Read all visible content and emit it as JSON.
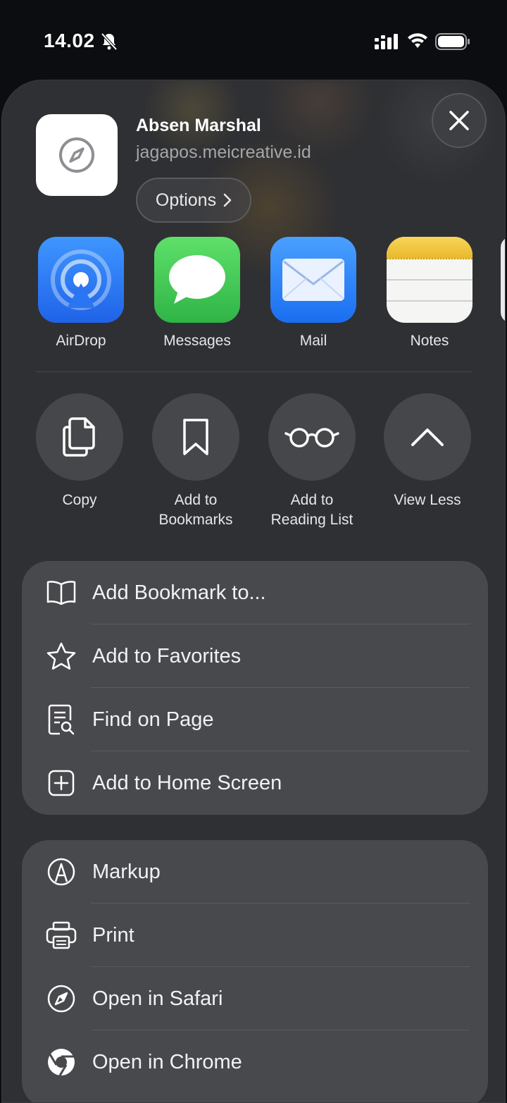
{
  "status_bar": {
    "time": "14.02",
    "icons": [
      "bell-slash-icon",
      "cellular-signal-icon",
      "wifi-icon",
      "battery-icon"
    ]
  },
  "header": {
    "title": "Absen Marshal",
    "subtitle": "jagapos.meicreative.id",
    "options_label": "Options",
    "app_icon": "safari-compass-icon",
    "close_icon": "close-icon"
  },
  "apps": [
    {
      "label": "AirDrop",
      "icon": "airdrop-icon",
      "color": "#2f7df6"
    },
    {
      "label": "Messages",
      "icon": "messages-icon",
      "color": "#34c759"
    },
    {
      "label": "Mail",
      "icon": "mail-icon",
      "color": "#1a82fb"
    },
    {
      "label": "Notes",
      "icon": "notes-icon",
      "color": "#f7d046"
    }
  ],
  "actions": [
    {
      "label": "Copy",
      "icon": "copy-icon"
    },
    {
      "label": "Add to\nBookmarks",
      "icon": "bookmark-icon"
    },
    {
      "label": "Add to\nReading List",
      "icon": "glasses-icon"
    },
    {
      "label": "View Less",
      "icon": "chevron-up-icon"
    }
  ],
  "menu_group_1": [
    {
      "label": "Add Bookmark to...",
      "icon": "book-icon"
    },
    {
      "label": "Add to Favorites",
      "icon": "star-icon"
    },
    {
      "label": "Find on Page",
      "icon": "find-on-page-icon"
    },
    {
      "label": "Add to Home Screen",
      "icon": "plus-square-icon"
    }
  ],
  "menu_group_2": [
    {
      "label": "Markup",
      "icon": "markup-icon"
    },
    {
      "label": "Print",
      "icon": "printer-icon"
    },
    {
      "label": "Open in Safari",
      "icon": "safari-icon"
    },
    {
      "label": "Open in Chrome",
      "icon": "chrome-icon"
    }
  ]
}
